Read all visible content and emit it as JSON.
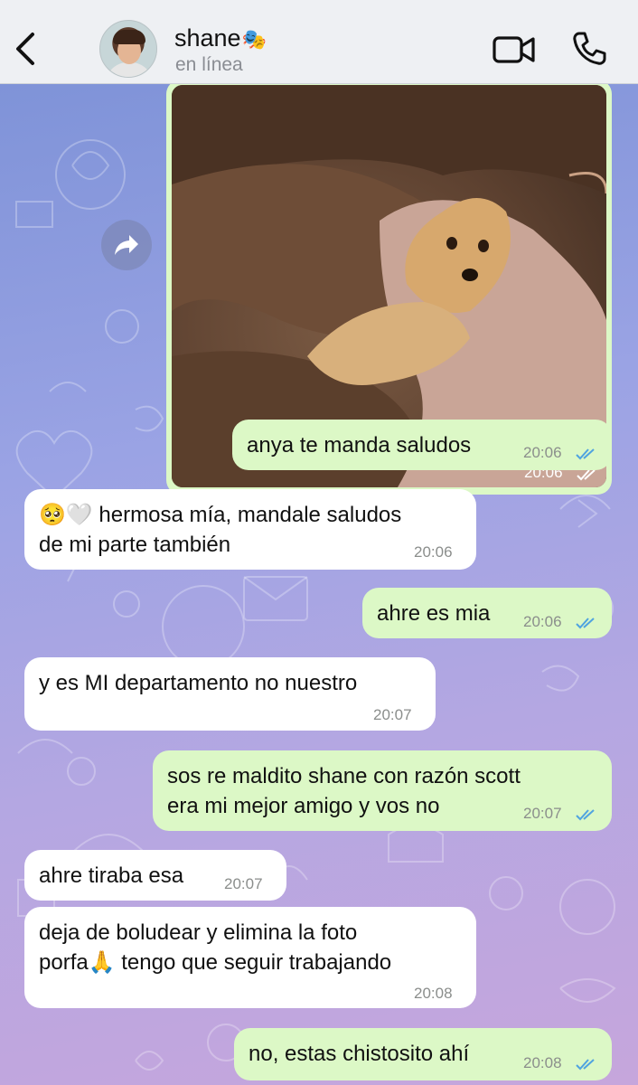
{
  "header": {
    "back_icon": "chevron-left-icon",
    "name": "shane",
    "name_emoji": "🎭",
    "status": "en línea",
    "video_icon": "video-camera-icon",
    "call_icon": "phone-icon"
  },
  "colors": {
    "outgoing_bubble": "#dcf8c6",
    "incoming_bubble": "#ffffff",
    "read_ticks": "#4fa3e0",
    "header_bg": "#eef0f3"
  },
  "messages": [
    {
      "type": "image",
      "direction": "out",
      "description_icon": "puppy-photo",
      "time": "20:06",
      "status": "read"
    },
    {
      "type": "text",
      "direction": "out",
      "text": "anya te manda saludos",
      "time": "20:06",
      "status": "read"
    },
    {
      "type": "text",
      "direction": "in",
      "text_line1": "🥺🤍 hermosa mía, mandale saludos",
      "text_line2": "de mi parte también",
      "time": "20:06"
    },
    {
      "type": "text",
      "direction": "out",
      "text": "ahre es mia",
      "time": "20:06",
      "status": "read"
    },
    {
      "type": "text",
      "direction": "in",
      "text": "y es MI departamento no nuestro",
      "time": "20:07"
    },
    {
      "type": "text",
      "direction": "out",
      "text_line1": "sos re maldito shane con razón scott",
      "text_line2": "era mi mejor amigo y vos no",
      "time": "20:07",
      "status": "read"
    },
    {
      "type": "text",
      "direction": "in",
      "text": "ahre tiraba esa",
      "time": "20:07"
    },
    {
      "type": "text",
      "direction": "in",
      "text_line1": "deja de boludear y elimina la foto",
      "text_line2": "porfa🙏 tengo que seguir trabajando",
      "time": "20:08"
    },
    {
      "type": "text",
      "direction": "out",
      "text": "no, estas chistosito ahí",
      "time": "20:08",
      "status": "read"
    }
  ]
}
